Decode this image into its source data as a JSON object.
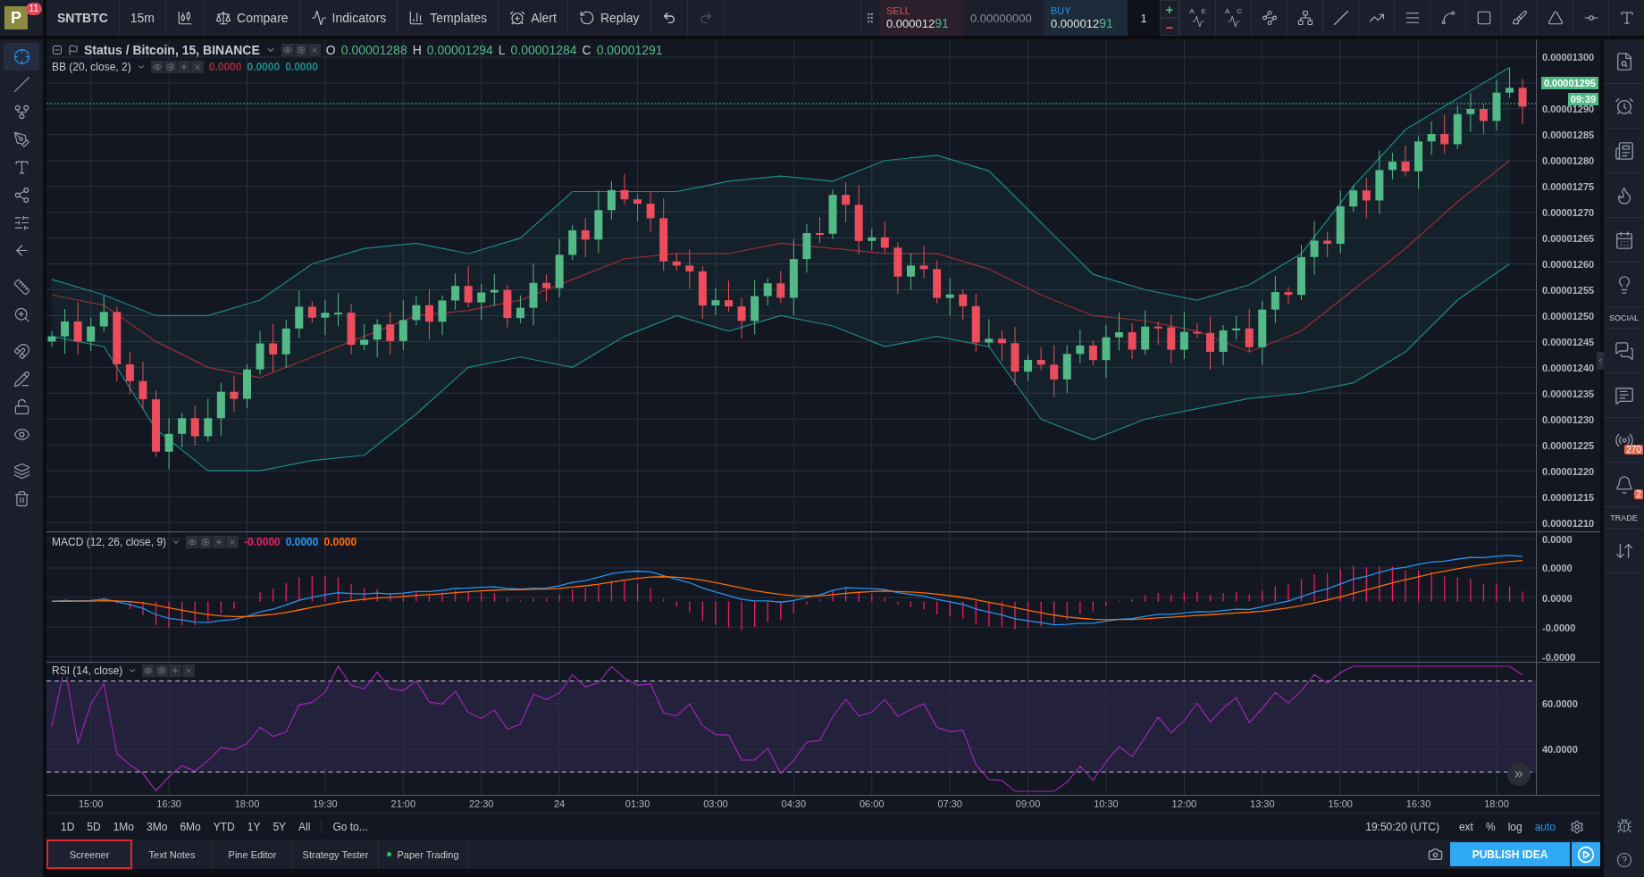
{
  "top_bar": {
    "avatar": {
      "letter": "P",
      "badge": "11"
    },
    "symbol": "SNTBTC",
    "interval": "15m",
    "buttons": [
      {
        "label": "Compare",
        "kind": "compare"
      },
      {
        "label": "Indicators",
        "kind": "indicators"
      },
      {
        "label": "Templates",
        "kind": "templates"
      },
      {
        "label": "Alert",
        "kind": "alert"
      },
      {
        "label": "Replay",
        "kind": "replay"
      }
    ],
    "undo": {
      "disabled": false
    },
    "redo": {
      "disabled": true
    }
  },
  "trade_panel": {
    "sell": {
      "label": "SELL",
      "price": "0.000012**91**"
    },
    "spread": "0.00000000",
    "buy": {
      "label": "BUY",
      "price": "0.000012**91**"
    },
    "quantity": "1",
    "plus": "+",
    "minus": "−"
  },
  "drawing_tools": [
    {
      "kind": "xabcd",
      "labels": [
        "A",
        "E"
      ]
    },
    {
      "kind": "abcd",
      "labels": [
        "A",
        "C"
      ]
    },
    {
      "kind": "head-shoulders"
    },
    {
      "kind": "elliott"
    },
    {
      "kind": "trend-line"
    },
    {
      "kind": "parallel"
    },
    {
      "kind": "fib"
    },
    {
      "kind": "fib-fan"
    },
    {
      "kind": "rectangle"
    },
    {
      "kind": "brush"
    },
    {
      "kind": "triangle"
    },
    {
      "kind": "horizontal-ray"
    },
    {
      "kind": "text"
    }
  ],
  "left_toolbar": [
    {
      "kind": "crosshair",
      "selected": true
    },
    {
      "kind": "line",
      "selected": false
    },
    {
      "kind": "pitchfork",
      "selected": false
    },
    {
      "kind": "brush",
      "selected": false
    },
    {
      "kind": "text",
      "selected": false
    },
    {
      "kind": "pattern",
      "selected": false
    },
    {
      "kind": "forecast",
      "selected": false
    },
    {
      "kind": "arrow",
      "selected": false
    },
    {
      "kind": "ruler",
      "selected": false
    },
    {
      "kind": "zoom",
      "selected": false
    },
    {
      "kind": "magnet",
      "selected": false
    },
    {
      "kind": "lock-drawing",
      "selected": false
    },
    {
      "kind": "lock",
      "selected": false
    },
    {
      "kind": "eye",
      "selected": false
    },
    {
      "kind": "layers",
      "selected": false
    },
    {
      "kind": "trash",
      "selected": false
    }
  ],
  "chart": {
    "title": "Status / Bitcoin, 15, BINANCE",
    "ohlc": [
      {
        "key": "O",
        "value": "0.00001288"
      },
      {
        "key": "H",
        "value": "0.00001294"
      },
      {
        "key": "L",
        "value": "0.00001284"
      },
      {
        "key": "C",
        "value": "0.00001291"
      }
    ],
    "bb": {
      "label": "BB (20, close, 2)",
      "values": [
        {
          "text": "0.0000",
          "color": "#9b2d3a"
        },
        {
          "text": "0.0000",
          "color": "#1e8a86"
        },
        {
          "text": "0.0000",
          "color": "#1e8a86"
        }
      ]
    },
    "price_axis": [
      "0.00001300",
      "0.00001290",
      "0.00001285",
      "0.00001280",
      "0.00001275",
      "0.00001270",
      "0.00001265",
      "0.00001260",
      "0.00001255",
      "0.00001250",
      "0.00001245",
      "0.00001240",
      "0.00001235",
      "0.00001230",
      "0.00001225",
      "0.00001220",
      "0.00001215",
      "0.00001210"
    ],
    "last_price": "0.00001295",
    "countdown": "09:39"
  },
  "macd": {
    "label": "MACD (12, 26, close, 9)",
    "values": [
      {
        "text": "-0.0000",
        "color": "#e91e63"
      },
      {
        "text": "0.0000",
        "color": "#2196f3"
      },
      {
        "text": "0.0000",
        "color": "#ff6d00"
      }
    ],
    "axis": [
      "0.0000",
      "0.0000",
      "0.0000",
      "-0.0000",
      "-0.0000"
    ]
  },
  "rsi": {
    "label": "RSI (14, close)",
    "axis": [
      "60.0000",
      "40.0000"
    ]
  },
  "time_axis": [
    "15:00",
    "16:30",
    "18:00",
    "19:30",
    "21:00",
    "22:30",
    "24",
    "01:30",
    "03:00",
    "04:30",
    "06:00",
    "07:30",
    "09:00",
    "10:30",
    "12:00",
    "13:30",
    "15:00",
    "16:30",
    "18:00"
  ],
  "range_bar": {
    "ranges": [
      "1D",
      "5D",
      "1Mo",
      "3Mo",
      "6Mo",
      "YTD",
      "1Y",
      "5Y",
      "All"
    ],
    "goto": "Go to...",
    "clock": "19:50:20 (UTC)",
    "toggles": [
      {
        "label": "ext",
        "selected": false
      },
      {
        "label": "%",
        "selected": false
      },
      {
        "label": "log",
        "selected": false
      },
      {
        "label": "auto",
        "selected": true
      }
    ]
  },
  "bottom_tabs": [
    {
      "label": "Screener",
      "selected": true,
      "online": false
    },
    {
      "label": "Text Notes",
      "selected": false,
      "online": false
    },
    {
      "label": "Pine Editor",
      "selected": false,
      "online": false
    },
    {
      "label": "Strategy Tester",
      "selected": false,
      "online": false
    },
    {
      "label": "Paper Trading",
      "selected": false,
      "online": true
    }
  ],
  "publish": "PUBLISH IDEA",
  "right_sidebar": [
    {
      "kind": "screener"
    },
    {
      "kind": "alarm"
    },
    {
      "kind": "watchlist"
    },
    {
      "kind": "hotlist"
    },
    {
      "kind": "calendar"
    },
    {
      "kind": "ideas"
    },
    {
      "kind": "heading",
      "label": "SOCIAL"
    },
    {
      "kind": "chat"
    },
    {
      "kind": "private-chat"
    },
    {
      "kind": "streams",
      "badge": "270"
    },
    {
      "kind": "notifications",
      "badge": "2"
    },
    {
      "kind": "heading",
      "label": "TRADE"
    },
    {
      "kind": "trading"
    }
  ],
  "sidebar_footer": [
    {
      "kind": "bug"
    },
    {
      "kind": "help"
    }
  ]
}
